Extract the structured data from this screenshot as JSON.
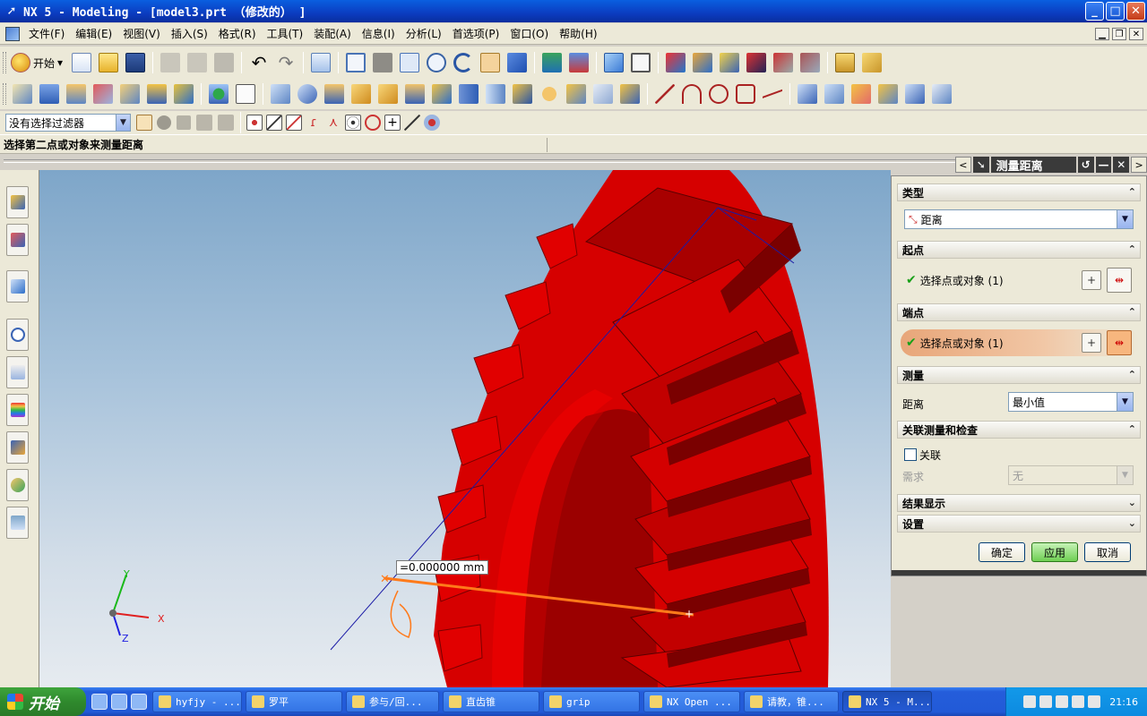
{
  "window": {
    "title": "NX 5 - Modeling - [model3.prt （修改的） ]",
    "min": "_",
    "max": "□",
    "close": "✕"
  },
  "menu": [
    "文件(F)",
    "编辑(E)",
    "视图(V)",
    "插入(S)",
    "格式(R)",
    "工具(T)",
    "装配(A)",
    "信息(I)",
    "分析(L)",
    "首选项(P)",
    "窗口(O)",
    "帮助(H)"
  ],
  "toolbar": {
    "start_label": "开始",
    "filter_value": "没有选择过滤器"
  },
  "cue": "选择第二点或对象来测量距离",
  "viewport": {
    "measure_label": "=0.000000 mm",
    "axis_x": "X",
    "axis_y": "Y",
    "axis_z": "Z"
  },
  "dialog": {
    "title": "测量距离",
    "type_section": "类型",
    "type_value": "距离",
    "start_section": "起点",
    "start_select": "选择点或对象 (1)",
    "end_section": "端点",
    "end_select": "选择点或对象 (1)",
    "measure_section": "测量",
    "distance_label": "距离",
    "distance_value": "最小值",
    "assoc_section": "关联测量和检查",
    "assoc_label": "关联",
    "require_label": "需求",
    "require_value": "无",
    "result_section": "结果显示",
    "settings_section": "设置",
    "ok": "确定",
    "apply": "应用",
    "cancel": "取消"
  },
  "taskbar": {
    "start": "开始",
    "tasks": [
      "hyfjy - ...",
      "罗平",
      "参与/回...",
      "直齿锥",
      "grip",
      "NX Open ...",
      "请教，锥...",
      "NX 5 - M..."
    ],
    "clock": "21:16"
  },
  "colors": {
    "gear": "#e00000",
    "measure_line": "#ff7a1a",
    "helper_line": "#1a1aa6",
    "accent": "#0b3cc0"
  }
}
